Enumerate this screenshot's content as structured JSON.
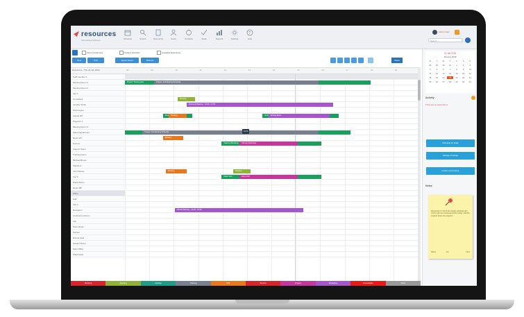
{
  "app": {
    "logo_text": "resources",
    "logo_sub": "Scheduling Software",
    "brand_color": "#2d4f7c"
  },
  "toolbar": [
    {
      "label": "Schedule",
      "icon": "calendar-icon"
    },
    {
      "label": "Search",
      "icon": "search-icon"
    },
    {
      "label": "Resources",
      "icon": "resource-icon"
    },
    {
      "label": "Users",
      "icon": "user-icon"
    },
    {
      "label": "Contacts",
      "icon": "contacts-icon"
    },
    {
      "label": "Tasks",
      "icon": "tasks-icon"
    },
    {
      "label": "Reports",
      "icon": "reports-icon"
    },
    {
      "label": "Settings",
      "icon": "settings-icon"
    },
    {
      "label": "Help",
      "icon": "help-icon"
    }
  ],
  "user": {
    "name": "Admin User",
    "search_placeholder": "Search..."
  },
  "filters": [
    "Show Unplanned",
    "Today's Activities",
    "Available Resources"
  ],
  "buttons": {
    "new": "New",
    "print": "Print",
    "export": "Export Excel",
    "refresh": "Refresh",
    "zoom": "Week"
  },
  "grid": {
    "header_label": "Resources - Thu 21 Jan 2016",
    "ticks": [
      "08",
      "09",
      "10",
      "11",
      "12",
      "13",
      "14",
      "15",
      "16",
      "17",
      "18",
      "19"
    ],
    "rows": [
      "Staff member 1",
      "Meeting Room 1",
      "Meeting Room 2",
      "Van 1",
      "Consultant",
      "Jennifer Smith",
      "Photocopier",
      "Laptop HP",
      "Projector 1",
      "Meeting Room 3",
      "Sales Department",
      "Room 2A",
      "Team A",
      "Support Team",
      "Training Room",
      "Michael Brown",
      "Vehicle 2",
      "John Davies",
      "Car 3",
      "Board Room",
      "Room 3B",
      "Office",
      "Hall",
      "Van 2",
      "Reception",
      "Conference Room",
      "Lab",
      "Store Room",
      "Kitchen",
      "Events Area",
      "Garden Room",
      "Main Office",
      "Warehouse"
    ],
    "selected_row": 21,
    "bars": [
      {
        "row": 1,
        "label": "Project: Sharing plan",
        "start": 0.0,
        "end": 0.1,
        "color": "#1e9d5e"
      },
      {
        "row": 1,
        "label": "Project: Full Meeting Schedule",
        "start": 0.1,
        "end": 0.66,
        "color": "#7a7f8e"
      },
      {
        "row": 1,
        "label": "",
        "start": 0.66,
        "end": 0.84,
        "color": "#1e9d5e"
      },
      {
        "row": 4,
        "label": "Booking",
        "start": 0.18,
        "end": 0.24,
        "color": "#8fb33b"
      },
      {
        "row": 5,
        "label": "All Hands Meeting - 10:00 - 17:00",
        "start": 0.21,
        "end": 0.71,
        "color": "#a259c7"
      },
      {
        "row": 7,
        "label": "Booking",
        "start": 0.13,
        "end": 0.23,
        "color": "#1e9d5e"
      },
      {
        "row": 7,
        "label": "Booking",
        "start": 0.15,
        "end": 0.21,
        "color": "#e8781e"
      },
      {
        "row": 7,
        "label": "All Day Event",
        "start": 0.47,
        "end": 0.73,
        "color": "#1e9d5e"
      },
      {
        "row": 7,
        "label": "All Day Event",
        "start": 0.49,
        "end": 0.7,
        "color": "#a259c7"
      },
      {
        "row": 10,
        "label": "",
        "start": 0.0,
        "end": 0.06,
        "color": "#1e9d5e"
      },
      {
        "row": 10,
        "label": "Project: Full Meeting Schedule",
        "start": 0.06,
        "end": 0.66,
        "color": "#7a7f8e"
      },
      {
        "row": 10,
        "label": "",
        "start": 0.66,
        "end": 0.77,
        "color": "#1e9d5e"
      },
      {
        "row": 11,
        "label": "Booking",
        "start": 0.13,
        "end": 0.2,
        "color": "#e8781e"
      },
      {
        "row": 12,
        "label": "Training Workshop",
        "start": 0.33,
        "end": 0.67,
        "color": "#1e9d5e"
      },
      {
        "row": 12,
        "label": "Training Workshop",
        "start": 0.39,
        "end": 0.59,
        "color": "#c2399b"
      },
      {
        "row": 17,
        "label": "Booking",
        "start": 0.14,
        "end": 0.21,
        "color": "#e8781e"
      },
      {
        "row": 17,
        "label": "Booking",
        "start": 0.37,
        "end": 0.43,
        "color": "#8fb33b"
      },
      {
        "row": 18,
        "label": "Client Visit",
        "start": 0.33,
        "end": 0.67,
        "color": "#1e9d5e"
      },
      {
        "row": 18,
        "label": "Client Visit",
        "start": 0.39,
        "end": 0.59,
        "color": "#c2399b"
      },
      {
        "row": 24,
        "label": "Off-site Meeting - 10:00 - 16:00",
        "start": 0.17,
        "end": 0.61,
        "color": "#a259c7"
      }
    ],
    "tooltip": {
      "row": 10,
      "label": "12:00"
    }
  },
  "bottom_bar": [
    {
      "label": "Booking",
      "color": "#d7262b"
    },
    {
      "label": "Meeting",
      "color": "#8fb33b"
    },
    {
      "label": "Holiday",
      "color": "#1e9d8a"
    },
    {
      "label": "Training",
      "color": "#7a7f8e"
    },
    {
      "label": "Sick",
      "color": "#e8781e"
    },
    {
      "label": "Service",
      "color": "#d7262b"
    },
    {
      "label": "Project",
      "color": "#c2399b"
    },
    {
      "label": "Workshop",
      "color": "#a259c7"
    },
    {
      "label": "Unavailable",
      "color": "#e81a1a"
    },
    {
      "label": "Other",
      "color": "#999999"
    }
  ],
  "calendar": {
    "title": "21 Jan 2016",
    "month": "January 2016",
    "days": [
      "M",
      "T",
      "W",
      "T",
      "F",
      "S",
      "S",
      "28",
      "29",
      "30",
      "31",
      "1",
      "2",
      "3",
      "4",
      "5",
      "6",
      "7",
      "8",
      "9",
      "10",
      "11",
      "12",
      "13",
      "14",
      "15",
      "16",
      "17",
      "18",
      "19",
      "20",
      "21",
      "22",
      "23",
      "24",
      "25",
      "26",
      "27",
      "28",
      "29",
      "30",
      "31"
    ],
    "today": "21"
  },
  "activity": {
    "title": "Activity",
    "text": "There are no recent items"
  },
  "side_buttons": [
    "Schedule for today",
    "Manage bookings",
    "Create new booking"
  ],
  "notes": {
    "title": "Notes",
    "text": "Remember to check the weekly schedule and confirm all room bookings before Friday. Call the supplier about the projector.",
    "footer_left": "Sticky",
    "footer_mid": "1/3",
    "footer_right": "Next"
  }
}
